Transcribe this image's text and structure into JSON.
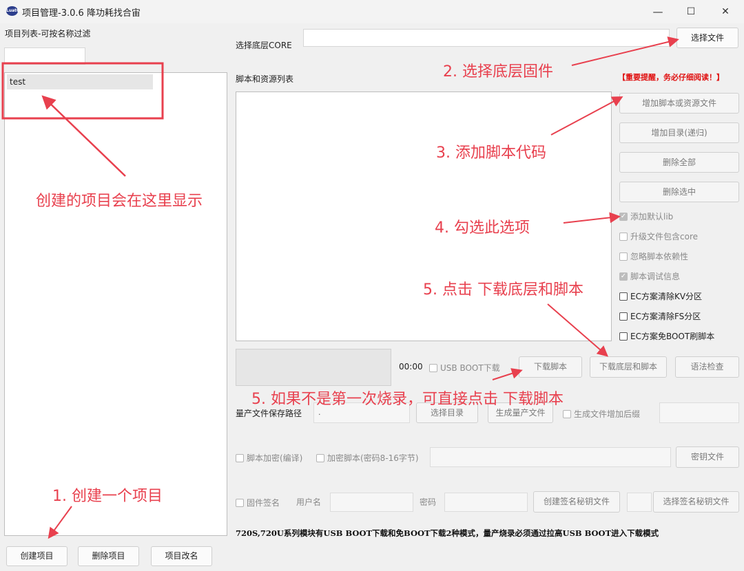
{
  "window": {
    "title": "项目管理-3.0.6 降功耗找合宙",
    "icon": "app-logo-icon",
    "controls": {
      "minimize": "—",
      "maximize": "☐",
      "close": "✕"
    }
  },
  "left": {
    "header": "项目列表-可按名称过滤",
    "filter_value": "",
    "projects": [
      "test"
    ],
    "buttons": {
      "create": "创建项目",
      "delete": "删除项目",
      "rename": "项目改名"
    }
  },
  "core": {
    "label": "选择底层CORE",
    "value": "",
    "button": "选择文件"
  },
  "scripts": {
    "label": "脚本和资源列表",
    "warning": "【重要提醒，务必仔细阅读！】",
    "buttons": {
      "add_file": "增加脚本或资源文件",
      "add_dir": "增加目录(递归)",
      "remove_all": "删除全部",
      "remove_selected": "删除选中"
    },
    "options": [
      {
        "label": "添加默认lib",
        "checked": true,
        "disabled": true
      },
      {
        "label": "升级文件包含core",
        "checked": false,
        "disabled": true
      },
      {
        "label": "忽略脚本依赖性",
        "checked": false,
        "disabled": true
      },
      {
        "label": "脚本调试信息",
        "checked": true,
        "disabled": true
      },
      {
        "label": "EC方案清除KV分区",
        "checked": false,
        "disabled": false
      },
      {
        "label": "EC方案清除FS分区",
        "checked": false,
        "disabled": false
      },
      {
        "label": "EC方案免BOOT刷脚本",
        "checked": false,
        "disabled": false
      }
    ]
  },
  "download": {
    "timer": "00:00",
    "usb_boot_label": "USB BOOT下载",
    "download_script": "下载脚本",
    "download_core_script": "下载底层和脚本",
    "syntax_check": "语法检查"
  },
  "production": {
    "label": "量产文件保存路径",
    "path_value": ".",
    "choose_dir": "选择目录",
    "generate": "生成量产文件",
    "suffix_label": "生成文件增加后缀",
    "suffix_value": ""
  },
  "encryption": {
    "compile_label": "脚本加密(编译)",
    "encrypt_label": "加密脚本(密码8-16字节)",
    "key_value": "",
    "key_file": "密钥文件"
  },
  "signing": {
    "label": "固件签名",
    "username_label": "用户名",
    "username_value": "",
    "password_label": "密码",
    "password_value": "",
    "create_key": "创建签名秘钥文件",
    "choose_key": "选择签名秘钥文件"
  },
  "footer_note": "720S,720U系列模块有USB BOOT下载和免BOOT下载2种模式，量产烧录必须通过拉高USB BOOT进入下载模式",
  "annotations": {
    "a1": "1. 创建一个项目",
    "a2": "2. 选择底层固件",
    "a3": "3. 添加脚本代码",
    "a4": "4. 勾选此选项",
    "a5": "5. 点击 下载底层和脚本",
    "a5b": "5. 如果不是第一次烧录，可直接点击 下载脚本",
    "note": "创建的项目会在这里显示"
  },
  "colors": {
    "annotation": "#e8404e",
    "warning": "#e01010",
    "window_bg": "#f0f0f0"
  }
}
